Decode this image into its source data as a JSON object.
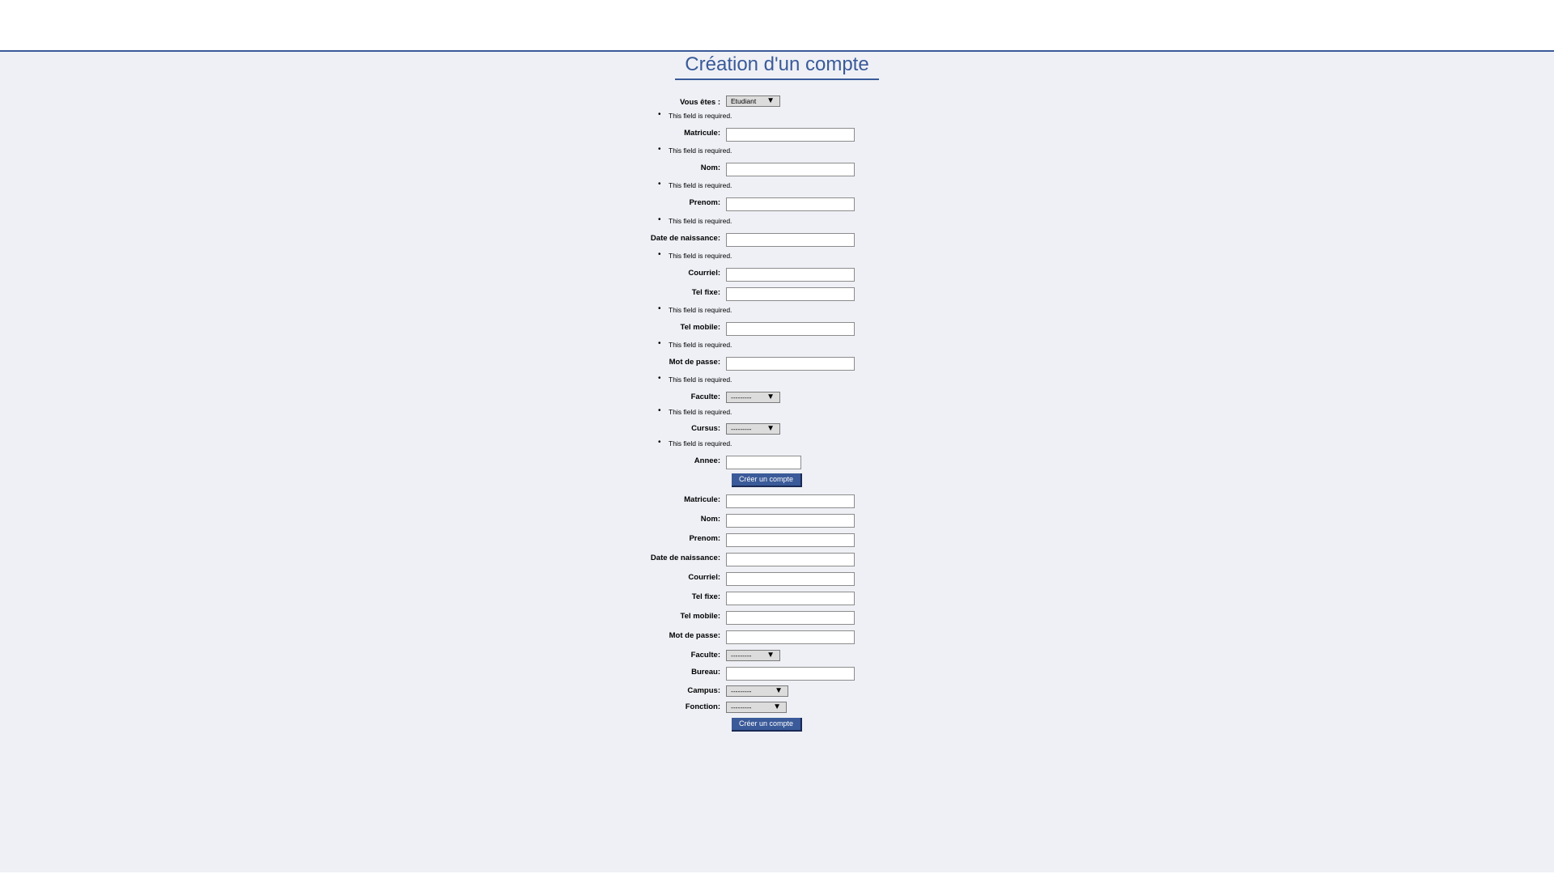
{
  "page": {
    "title": "Création d'un compte"
  },
  "form1": {
    "type_label": "Vous êtes :",
    "type_value": "Etudiant",
    "error_msg": "This field is required.",
    "labels": {
      "matricule": "Matricule:",
      "nom": "Nom:",
      "prenom": "Prenom:",
      "date_naissance": "Date de naissance:",
      "courriel": "Courriel:",
      "tel_fixe": "Tel fixe:",
      "tel_mobile": "Tel mobile:",
      "mot_de_passe": "Mot de passe:",
      "faculte": "Faculte:",
      "cursus": "Cursus:",
      "annee": "Annee:"
    },
    "faculte_value": "---------",
    "cursus_value": "---------",
    "submit_label": "Créer un compte"
  },
  "form2": {
    "labels": {
      "matricule": "Matricule:",
      "nom": "Nom:",
      "prenom": "Prenom:",
      "date_naissance": "Date de naissance:",
      "courriel": "Courriel:",
      "tel_fixe": "Tel fixe:",
      "tel_mobile": "Tel mobile:",
      "mot_de_passe": "Mot de passe:",
      "faculte": "Faculte:",
      "bureau": "Bureau:",
      "campus": "Campus:",
      "fonction": "Fonction:"
    },
    "faculte_value": "---------",
    "campus_value": "---------",
    "fonction_value": "---------",
    "submit_label": "Créer un compte"
  },
  "icons": {
    "dropdown": "chevron-down-icon",
    "bullet": "bullet-icon"
  },
  "colors": {
    "accent": "#3a5a99",
    "background": "#eef0f5"
  }
}
